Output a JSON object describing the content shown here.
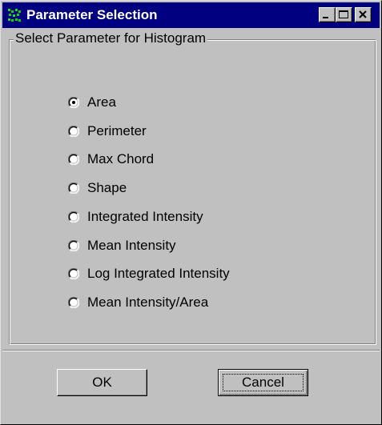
{
  "window": {
    "title": "Parameter Selection",
    "icon": "app-icon"
  },
  "titlebar_buttons": {
    "minimize": "minimize-icon",
    "maximize": "maximize-icon",
    "close": "close-icon"
  },
  "group": {
    "label": "Select Parameter for Histogram"
  },
  "options": [
    {
      "label": "Area",
      "selected": true
    },
    {
      "label": "Perimeter",
      "selected": false
    },
    {
      "label": "Max Chord",
      "selected": false
    },
    {
      "label": "Shape",
      "selected": false
    },
    {
      "label": "Integrated Intensity",
      "selected": false
    },
    {
      "label": "Mean Intensity",
      "selected": false
    },
    {
      "label": "Log Integrated Intensity",
      "selected": false
    },
    {
      "label": "Mean Intensity/Area",
      "selected": false
    }
  ],
  "buttons": {
    "ok_label": "OK",
    "cancel_label": "Cancel"
  },
  "colors": {
    "titlebar": "#000080",
    "face": "#c0c0c0"
  }
}
